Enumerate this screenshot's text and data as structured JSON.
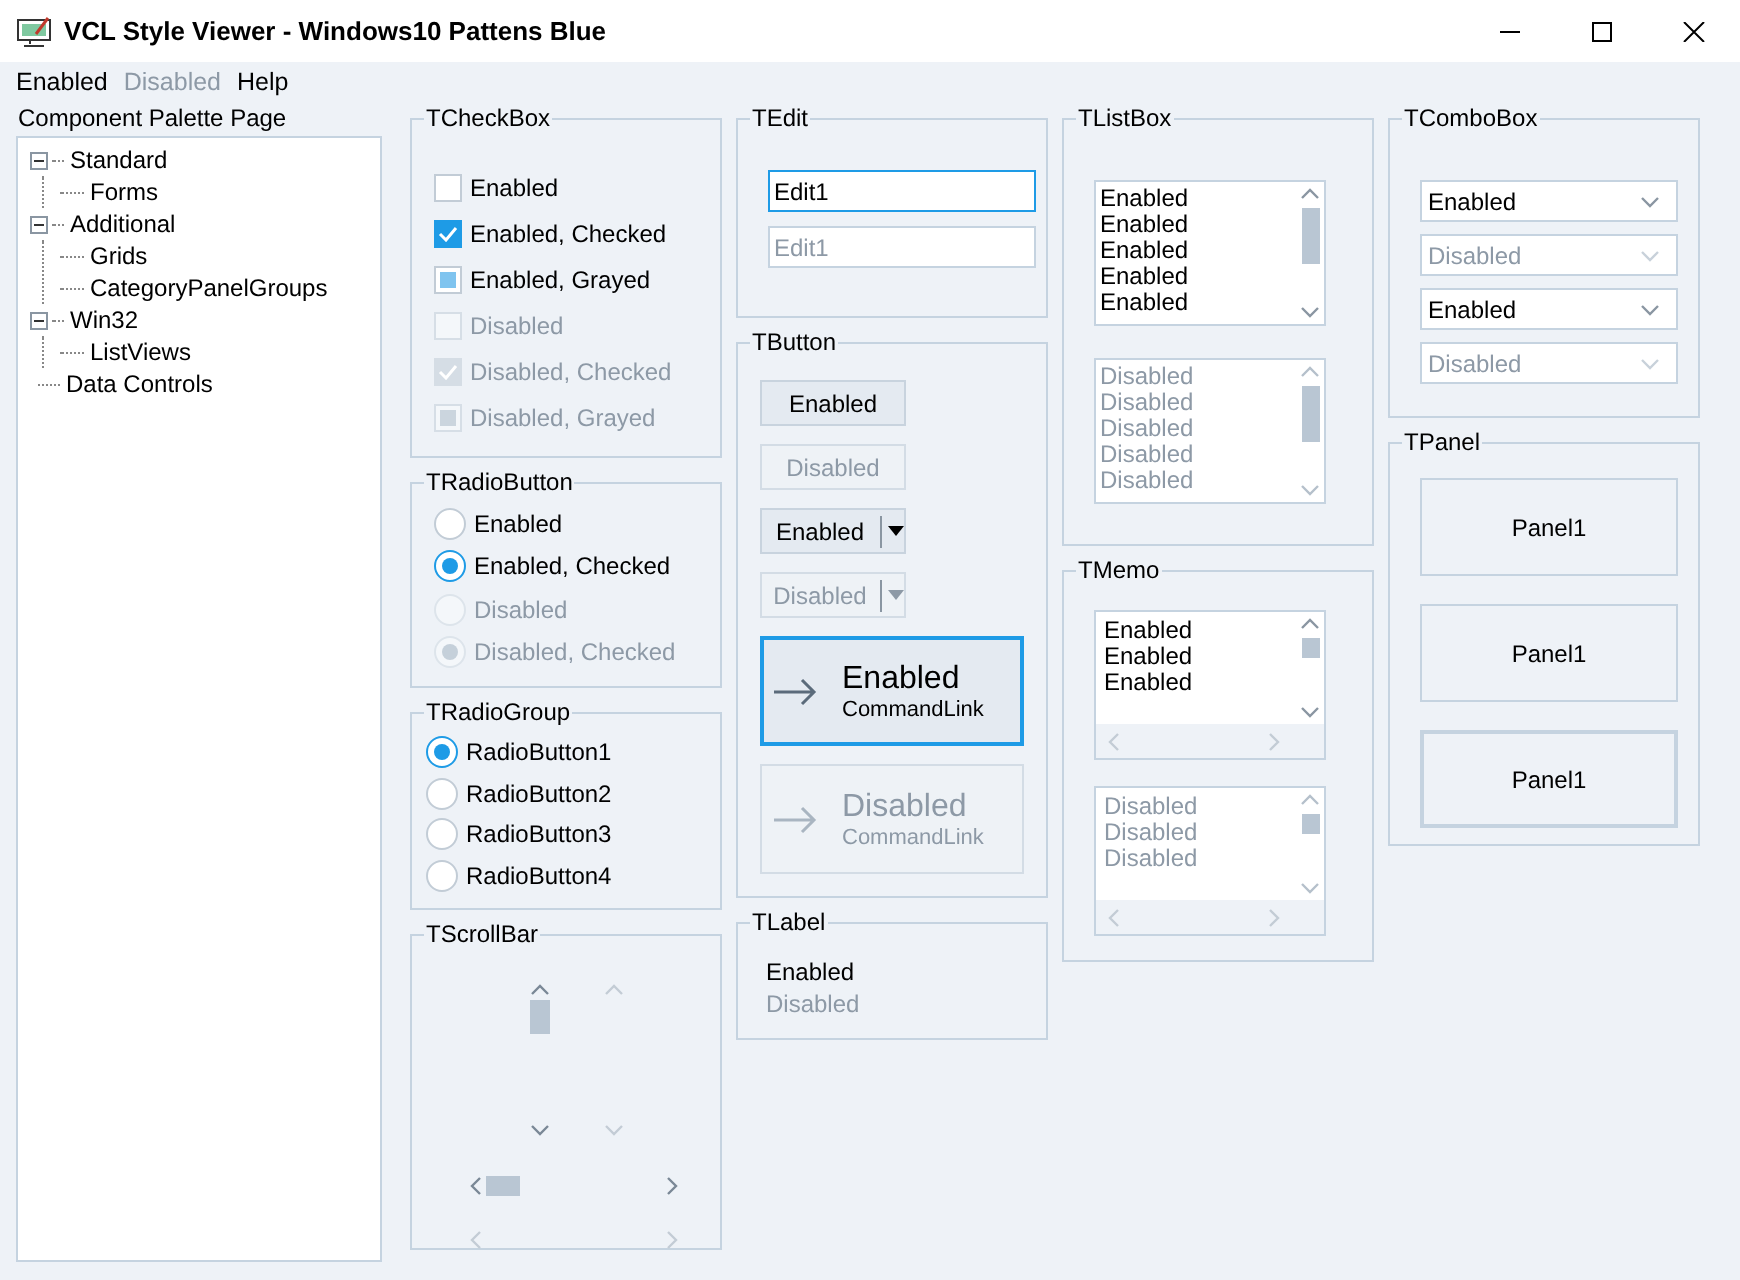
{
  "window": {
    "title": "VCL Style Viewer - Windows10 Pattens Blue"
  },
  "menu": [
    {
      "label": "Enabled",
      "disabled": false
    },
    {
      "label": "Disabled",
      "disabled": true
    },
    {
      "label": "Help",
      "disabled": false
    }
  ],
  "palette": {
    "label": "Component Palette Page",
    "tree": [
      {
        "label": "Standard",
        "expanded": true,
        "children": [
          {
            "label": "Forms"
          }
        ]
      },
      {
        "label": "Additional",
        "expanded": true,
        "children": [
          {
            "label": "Grids"
          },
          {
            "label": "CategoryPanelGroups"
          }
        ]
      },
      {
        "label": "Win32",
        "expanded": true,
        "children": [
          {
            "label": "ListViews"
          }
        ]
      },
      {
        "label": "Data Controls"
      }
    ]
  },
  "columns": [
    [
      {
        "title": "TCheckBox",
        "kind": "checkbox",
        "items": [
          {
            "label": "Enabled",
            "checked": false,
            "grayed": false,
            "disabled": false
          },
          {
            "label": "Enabled, Checked",
            "checked": true,
            "grayed": false,
            "disabled": false
          },
          {
            "label": "Enabled, Grayed",
            "checked": false,
            "grayed": true,
            "disabled": false
          },
          {
            "label": "Disabled",
            "checked": false,
            "grayed": false,
            "disabled": true
          },
          {
            "label": "Disabled, Checked",
            "checked": true,
            "grayed": false,
            "disabled": true
          },
          {
            "label": "Disabled, Grayed",
            "checked": false,
            "grayed": true,
            "disabled": true
          }
        ]
      },
      {
        "title": "TRadioButton",
        "kind": "radio",
        "items": [
          {
            "label": "Enabled",
            "selected": false,
            "disabled": false
          },
          {
            "label": "Enabled, Checked",
            "selected": true,
            "disabled": false
          },
          {
            "label": "Disabled",
            "selected": false,
            "disabled": true
          },
          {
            "label": "Disabled, Checked",
            "selected": true,
            "disabled": true
          }
        ]
      },
      {
        "title": "TRadioGroup",
        "kind": "radiogroup",
        "items": [
          {
            "label": "RadioButton1",
            "selected": true
          },
          {
            "label": "RadioButton2",
            "selected": false
          },
          {
            "label": "RadioButton3",
            "selected": false
          },
          {
            "label": "RadioButton4",
            "selected": false
          }
        ]
      },
      {
        "title": "TScrollBar",
        "kind": "scrollbar",
        "items": [
          {
            "kind": "vertical",
            "disabled": false
          },
          {
            "kind": "vertical",
            "disabled": true
          },
          {
            "kind": "horizontal",
            "disabled": false
          },
          {
            "kind": "horizontal",
            "disabled": true
          }
        ]
      }
    ],
    [
      {
        "title": "TEdit",
        "kind": "edit",
        "items": [
          {
            "value": "Edit1",
            "focused": true,
            "disabled": false
          },
          {
            "value": "Edit1",
            "focused": false,
            "disabled": true
          }
        ]
      },
      {
        "title": "TButton",
        "kind": "button",
        "items": [
          {
            "kind": "push",
            "label": "Enabled",
            "disabled": false
          },
          {
            "kind": "push",
            "label": "Disabled",
            "disabled": true
          },
          {
            "kind": "split",
            "label": "Enabled",
            "disabled": false
          },
          {
            "kind": "split",
            "label": "Disabled",
            "disabled": true
          },
          {
            "kind": "commandlink",
            "label": "Enabled",
            "note": "CommandLink",
            "focused": true,
            "disabled": false
          },
          {
            "kind": "commandlink",
            "label": "Disabled",
            "note": "CommandLink",
            "focused": false,
            "disabled": true
          }
        ]
      },
      {
        "title": "TLabel",
        "kind": "label",
        "items": [
          {
            "text": "Enabled",
            "disabled": false
          },
          {
            "text": "Disabled",
            "disabled": true
          }
        ]
      }
    ],
    [
      {
        "title": "TListBox",
        "kind": "listbox",
        "items": [
          {
            "lines": [
              "Enabled",
              "Enabled",
              "Enabled",
              "Enabled",
              "Enabled"
            ],
            "disabled": false
          },
          {
            "lines": [
              "Disabled",
              "Disabled",
              "Disabled",
              "Disabled",
              "Disabled"
            ],
            "disabled": true
          }
        ]
      },
      {
        "title": "TMemo",
        "kind": "memo",
        "items": [
          {
            "lines": [
              "Enabled",
              "Enabled",
              "Enabled"
            ],
            "disabled": false
          },
          {
            "lines": [
              "Disabled",
              "Disabled",
              "Disabled"
            ],
            "disabled": true
          }
        ]
      }
    ],
    [
      {
        "title": "TComboBox",
        "kind": "combobox",
        "items": [
          {
            "value": "Enabled",
            "disabled": false
          },
          {
            "value": "Disabled",
            "disabled": true
          },
          {
            "value": "Enabled",
            "disabled": false
          },
          {
            "value": "Disabled",
            "disabled": true
          }
        ]
      },
      {
        "title": "TPanel",
        "kind": "panel",
        "items": [
          {
            "caption": "Panel1",
            "thick_border": false
          },
          {
            "caption": "Panel1",
            "thick_border": false
          },
          {
            "caption": "Panel1",
            "thick_border": true
          }
        ]
      }
    ]
  ]
}
